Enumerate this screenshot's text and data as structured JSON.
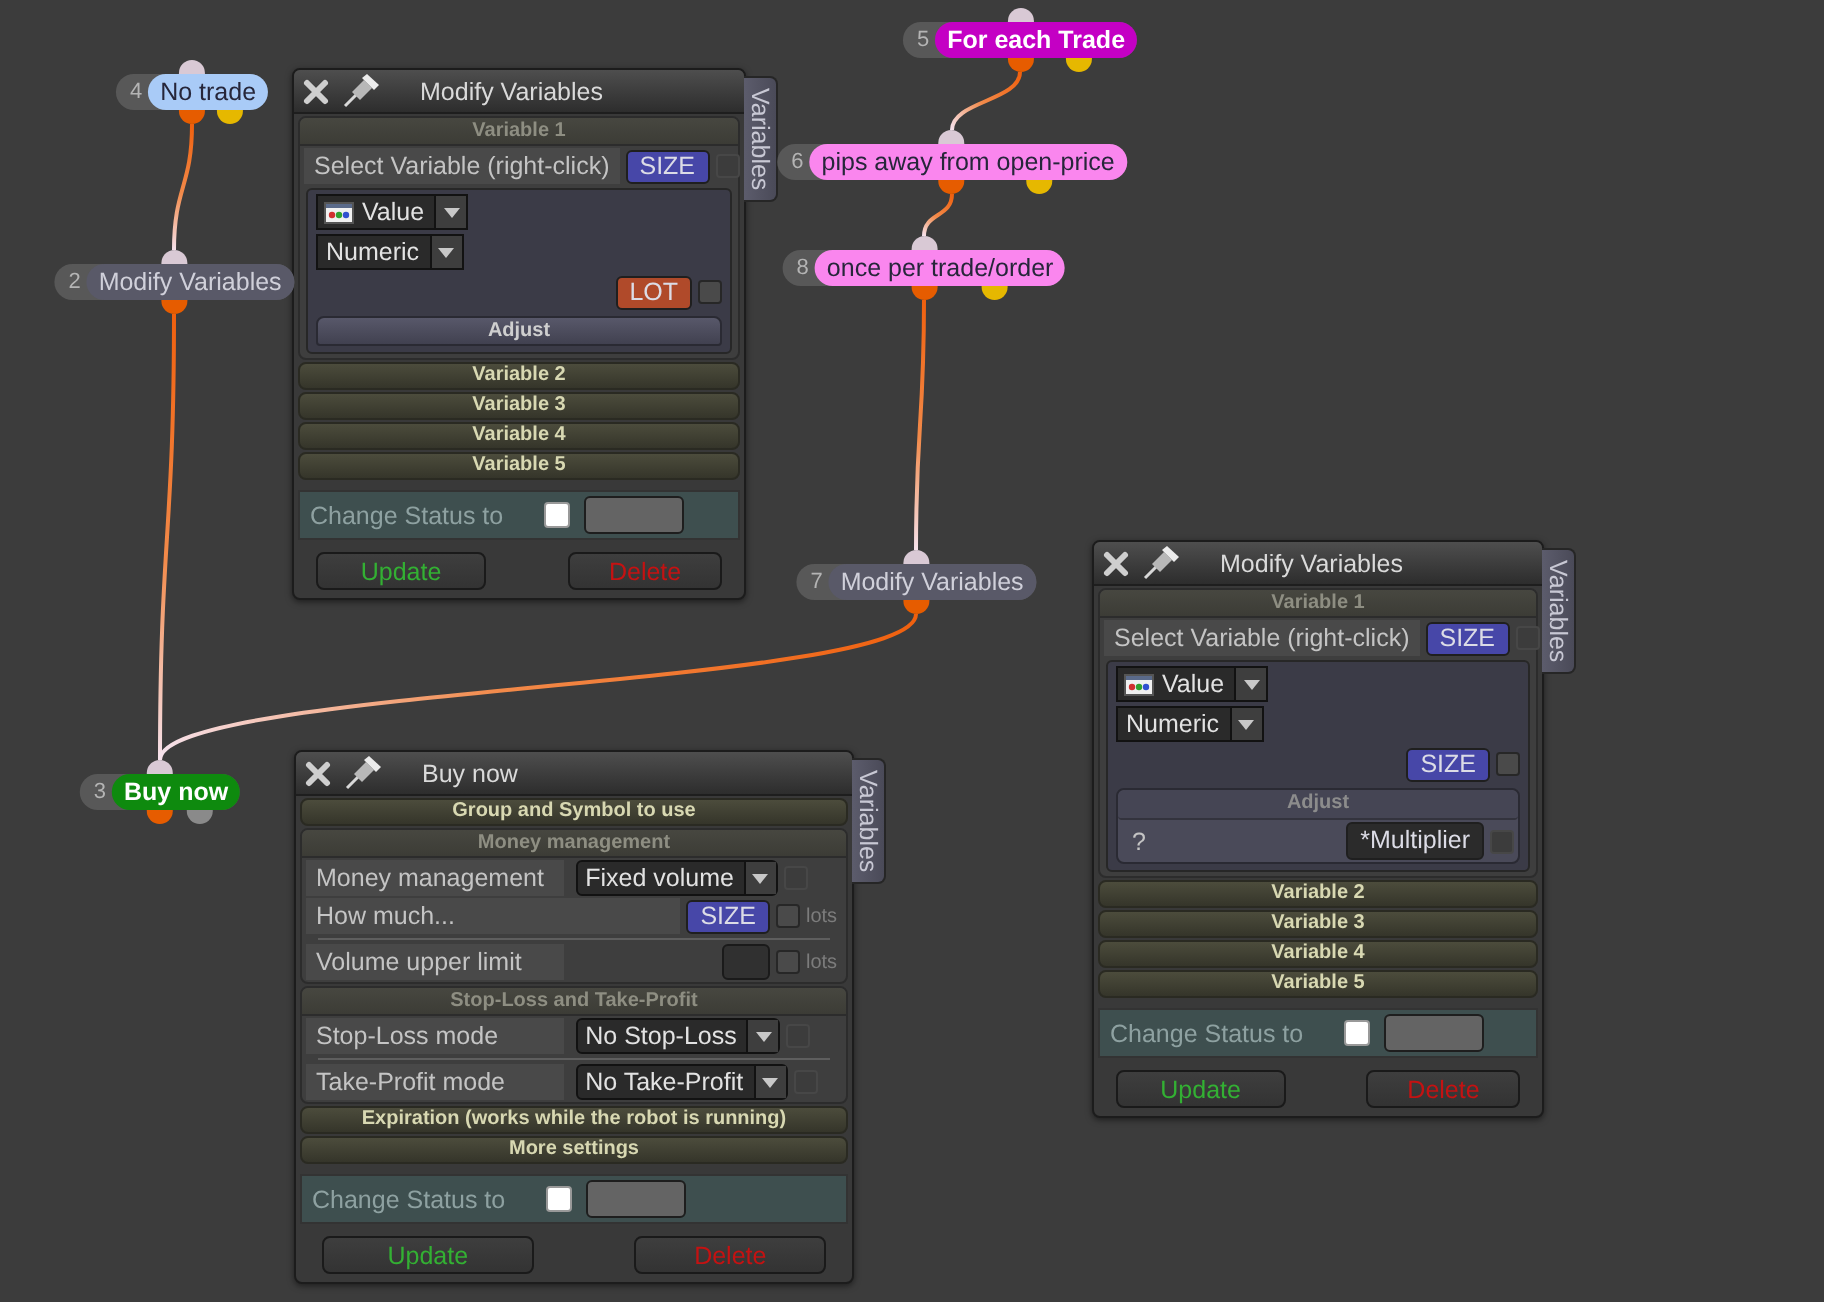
{
  "nodes": [
    {
      "number": "5",
      "label": "For each Trade",
      "color": "#c400c4",
      "outputs": [
        {
          "color": "#e65c00"
        },
        {
          "color": "#e6b800"
        }
      ]
    },
    {
      "number": "4",
      "label": "No trade",
      "color": "#a9cbf7",
      "outputs": [
        {
          "color": "#e65c00"
        },
        {
          "color": "#e6b800"
        }
      ]
    },
    {
      "number": "6",
      "label": "pips away from open-price",
      "color": "#fa86ee",
      "outputs": [
        {
          "color": "#e65c00"
        },
        {
          "color": "#e6b800"
        }
      ]
    },
    {
      "number": "8",
      "label": "once per trade/order",
      "color": "#fa86ee",
      "outputs": [
        {
          "color": "#e65c00"
        },
        {
          "color": "#e6b800"
        }
      ]
    },
    {
      "number": "2",
      "label": "Modify Variables",
      "color": "#595968",
      "outputs": [
        {
          "color": "#e65c00"
        }
      ]
    },
    {
      "number": "7",
      "label": "Modify Variables",
      "color": "#595968",
      "outputs": [
        {
          "color": "#e65c00"
        }
      ]
    },
    {
      "number": "3",
      "label": "Buy now",
      "color": "#0e8a0e",
      "outputs": [
        {
          "color": "#e65c00"
        },
        {
          "color": "#8a8a8a"
        }
      ]
    }
  ],
  "windows": [
    {
      "title": "Modify Variables",
      "side_tab": "Variables",
      "sections": [
        {
          "title": "Variable 1",
          "expanded": true,
          "rows": [
            {
              "kind": "button",
              "label": "Select Variable (right-click)",
              "button": {
                "label": "SIZE",
                "color": "#4747a8"
              },
              "checkbox": {
                "checked": false,
                "disabled": true
              }
            },
            {
              "kind": "group",
              "rows": [
                {
                  "kind": "dropdown",
                  "value": "Value",
                  "icon": true
                },
                {
                  "kind": "dropdown",
                  "value": "Numeric",
                  "icon": false
                },
                {
                  "kind": "button",
                  "button": {
                    "label": "LOT",
                    "color": "#b04a2a"
                  },
                  "checkbox": {
                    "checked": false,
                    "disabled": false
                  }
                },
                {
                  "kind": "subsection",
                  "title": "Adjust",
                  "expanded": false
                }
              ]
            }
          ]
        },
        {
          "title": "Variable 2",
          "expanded": false
        },
        {
          "title": "Variable 3",
          "expanded": false
        },
        {
          "title": "Variable 4",
          "expanded": false
        },
        {
          "title": "Variable 5",
          "expanded": false
        }
      ],
      "status": {
        "label": "Change Status to",
        "checked": false
      },
      "buttons": [
        {
          "label": "Update",
          "kind": "update"
        },
        {
          "label": "Delete",
          "kind": "delete"
        }
      ]
    },
    {
      "title": "Modify Variables",
      "side_tab": "Variables",
      "sections": [
        {
          "title": "Variable 1",
          "expanded": true,
          "rows": [
            {
              "kind": "button",
              "label": "Select Variable (right-click)",
              "button": {
                "label": "SIZE",
                "color": "#4747a8"
              },
              "checkbox": {
                "checked": false,
                "disabled": true
              }
            },
            {
              "kind": "group",
              "rows": [
                {
                  "kind": "dropdown",
                  "value": "Value",
                  "icon": true
                },
                {
                  "kind": "dropdown",
                  "value": "Numeric",
                  "icon": false
                },
                {
                  "kind": "button",
                  "button": {
                    "label": "SIZE",
                    "color": "#4747a8"
                  },
                  "checkbox": {
                    "checked": false,
                    "disabled": false
                  }
                },
                {
                  "kind": "subsection",
                  "title": "Adjust",
                  "expanded": true,
                  "rows": [
                    {
                      "kind": "button",
                      "label": "?",
                      "button": {
                        "label": "*Multiplier",
                        "color": "#2b2b2b"
                      },
                      "checkbox": {
                        "checked": false,
                        "disabled": true
                      }
                    }
                  ]
                }
              ]
            }
          ]
        },
        {
          "title": "Variable 2",
          "expanded": false
        },
        {
          "title": "Variable 3",
          "expanded": false
        },
        {
          "title": "Variable 4",
          "expanded": false
        },
        {
          "title": "Variable 5",
          "expanded": false
        }
      ],
      "status": {
        "label": "Change Status to",
        "checked": false
      },
      "buttons": [
        {
          "label": "Update",
          "kind": "update"
        },
        {
          "label": "Delete",
          "kind": "delete"
        }
      ]
    },
    {
      "title": "Buy now",
      "side_tab": "Variables",
      "sections": [
        {
          "title": "Group and Symbol to use",
          "expanded": false
        },
        {
          "title": "Money management",
          "expanded": true,
          "rows": [
            {
              "kind": "dropdown",
              "label": "Money management",
              "value": "Fixed volume",
              "icon": false,
              "checkbox": {
                "checked": false,
                "disabled": true
              }
            },
            {
              "kind": "button",
              "label": "How much...",
              "button": {
                "label": "SIZE",
                "color": "#4747a8"
              },
              "checkbox": {
                "checked": false,
                "disabled": false
              },
              "unit": "lots"
            },
            {
              "kind": "divider"
            },
            {
              "kind": "input",
              "label": "Volume upper limit",
              "checkbox": {
                "checked": false,
                "disabled": false
              },
              "unit": "lots"
            }
          ]
        },
        {
          "title": "Stop-Loss and Take-Profit",
          "expanded": true,
          "rows": [
            {
              "kind": "dropdown",
              "label": "Stop-Loss mode",
              "value": "No Stop-Loss",
              "icon": false,
              "checkbox": {
                "checked": false,
                "disabled": true
              }
            },
            {
              "kind": "divider"
            },
            {
              "kind": "dropdown",
              "label": "Take-Profit mode",
              "value": "No Take-Profit",
              "icon": false,
              "checkbox": {
                "checked": false,
                "disabled": true
              }
            }
          ]
        },
        {
          "title": "Expiration (works while the robot is running)",
          "expanded": false
        },
        {
          "title": "More settings",
          "expanded": false
        }
      ],
      "status": {
        "label": "Change Status to",
        "checked": false
      },
      "buttons": [
        {
          "label": "Update",
          "kind": "update"
        },
        {
          "label": "Delete",
          "kind": "delete"
        }
      ]
    }
  ]
}
